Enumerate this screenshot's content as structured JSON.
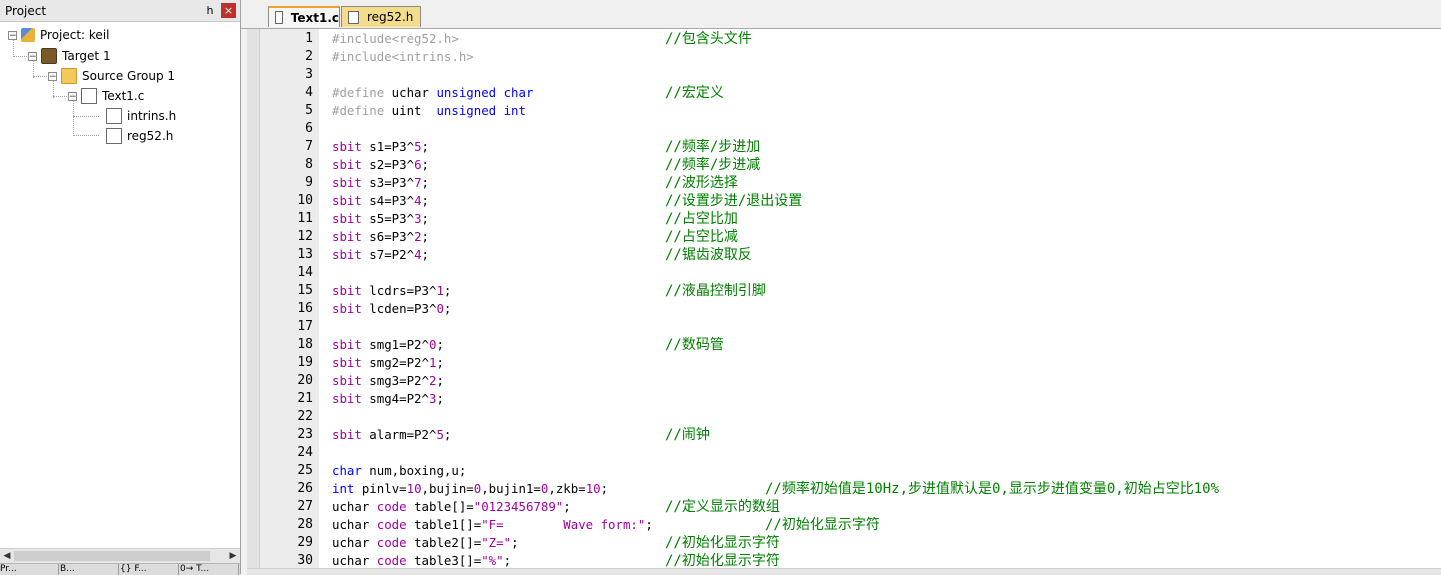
{
  "project_panel": {
    "title": "Project",
    "pin_label": "հ",
    "close_label": "×",
    "tree": {
      "project": "Project: keil",
      "target": "Target 1",
      "group": "Source Group 1",
      "file": "Text1.c",
      "headers": [
        "intrins.h",
        "reg52.h"
      ]
    },
    "bottom_tabs": [
      "Pr...",
      "B...",
      "{} F...",
      "0→ T..."
    ]
  },
  "editor_tabs": [
    {
      "label": "Text1.c",
      "active": true
    },
    {
      "label": "reg52.h",
      "active": false
    }
  ],
  "code_lines": [
    {
      "n": "1",
      "code": "#include<reg52.h>",
      "comment": "//包含头文件"
    },
    {
      "n": "2",
      "code": "#include<intrins.h>",
      "comment": ""
    },
    {
      "n": "3",
      "code": "",
      "comment": ""
    },
    {
      "n": "4",
      "code": "#define uchar unsigned char",
      "comment": "//宏定义"
    },
    {
      "n": "5",
      "code": "#define uint  unsigned int",
      "comment": ""
    },
    {
      "n": "6",
      "code": "",
      "comment": ""
    },
    {
      "n": "7",
      "code": "sbit s1=P3^5;",
      "comment": "//频率/步进加"
    },
    {
      "n": "8",
      "code": "sbit s2=P3^6;",
      "comment": "//频率/步进减"
    },
    {
      "n": "9",
      "code": "sbit s3=P3^7;",
      "comment": "//波形选择"
    },
    {
      "n": "10",
      "code": "sbit s4=P3^4;",
      "comment": "//设置步进/退出设置"
    },
    {
      "n": "11",
      "code": "sbit s5=P3^3;",
      "comment": "//占空比加"
    },
    {
      "n": "12",
      "code": "sbit s6=P3^2;",
      "comment": "//占空比减"
    },
    {
      "n": "13",
      "code": "sbit s7=P2^4;",
      "comment": "//锯齿波取反"
    },
    {
      "n": "14",
      "code": "",
      "comment": ""
    },
    {
      "n": "15",
      "code": "sbit lcdrs=P3^1;",
      "comment": "//液晶控制引脚"
    },
    {
      "n": "16",
      "code": "sbit lcden=P3^0;",
      "comment": ""
    },
    {
      "n": "17",
      "code": "",
      "comment": ""
    },
    {
      "n": "18",
      "code": "sbit smg1=P2^0;",
      "comment": "//数码管"
    },
    {
      "n": "19",
      "code": "sbit smg2=P2^1;",
      "comment": ""
    },
    {
      "n": "20",
      "code": "sbit smg3=P2^2;",
      "comment": ""
    },
    {
      "n": "21",
      "code": "sbit smg4=P2^3;",
      "comment": ""
    },
    {
      "n": "22",
      "code": "",
      "comment": ""
    },
    {
      "n": "23",
      "code": "sbit alarm=P2^5;",
      "comment": "//闹钟"
    },
    {
      "n": "24",
      "code": "",
      "comment": ""
    },
    {
      "n": "25",
      "code": "char num,boxing,u;",
      "comment": ""
    },
    {
      "n": "26",
      "code": "int pinlv=10,bujin=0,bujin1=0,zkb=10;",
      "comment": "//频率初始值是10Hz,步进值默认是0,显示步进值变量0,初始占空比10%"
    },
    {
      "n": "27",
      "code": "uchar code table[]=\"0123456789\";",
      "comment": "//定义显示的数组"
    },
    {
      "n": "28",
      "code": "uchar code table1[]=\"F=        Wave form:\";",
      "comment": "//初始化显示字符"
    },
    {
      "n": "29",
      "code": "uchar code table2[]=\"Z=\";",
      "comment": "//初始化显示字符"
    },
    {
      "n": "30",
      "code": "uchar code table3[]=\"%\";",
      "comment": "//初始化显示字符"
    }
  ],
  "colors": {
    "comment": "#008000",
    "keyword": "#a000a0",
    "type": "#0000ff",
    "preprocessor": "#a0a0a0",
    "active_tab_accent": "#f0a030"
  }
}
